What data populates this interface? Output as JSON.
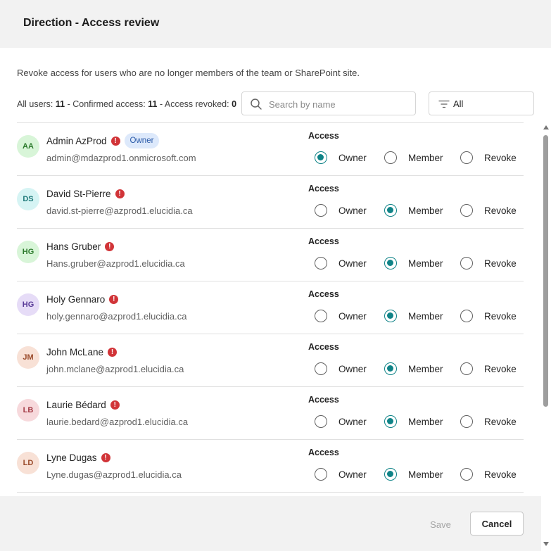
{
  "dialog": {
    "title": "Direction - Access review",
    "description": "Revoke access for users who are no longer members of the team or SharePoint site."
  },
  "stats": {
    "all_users_label": "All users:",
    "all_users_count": "11",
    "confirmed_label": "- Confirmed access:",
    "confirmed_count": "11",
    "revoked_label": "- Access revoked:",
    "revoked_count": "0"
  },
  "search": {
    "placeholder": "Search by name",
    "value": ""
  },
  "filter": {
    "label": "All"
  },
  "column": {
    "access_label": "Access"
  },
  "options": {
    "owner": "Owner",
    "member": "Member",
    "revoke": "Revoke"
  },
  "badges": {
    "owner": "Owner"
  },
  "users": [
    {
      "initials": "AA",
      "name": "Admin AzProd",
      "email": "admin@mdazprod1.onmicrosoft.com",
      "access": "owner",
      "badge": true,
      "avatar_bg": "#d8f5d8",
      "avatar_fg": "#2c7a2c"
    },
    {
      "initials": "DS",
      "name": "David St-Pierre",
      "email": "david.st-pierre@azprod1.elucidia.ca",
      "access": "member",
      "badge": false,
      "avatar_bg": "#d6f4f4",
      "avatar_fg": "#1f7a7a"
    },
    {
      "initials": "HG",
      "name": "Hans Gruber",
      "email": "Hans.gruber@azprod1.elucidia.ca",
      "access": "member",
      "badge": false,
      "avatar_bg": "#d8f5d8",
      "avatar_fg": "#2c7a2c"
    },
    {
      "initials": "HG",
      "name": "Holy Gennaro",
      "email": "holy.gennaro@azprod1.elucidia.ca",
      "access": "member",
      "badge": false,
      "avatar_bg": "#e6dcf7",
      "avatar_fg": "#5a3b99"
    },
    {
      "initials": "JM",
      "name": "John McLane",
      "email": "john.mclane@azprod1.elucidia.ca",
      "access": "member",
      "badge": false,
      "avatar_bg": "#f8e1d6",
      "avatar_fg": "#9a4a2a"
    },
    {
      "initials": "LB",
      "name": "Laurie Bédard",
      "email": "laurie.bedard@azprod1.elucidia.ca",
      "access": "member",
      "badge": false,
      "avatar_bg": "#f7d9dc",
      "avatar_fg": "#a33a45"
    },
    {
      "initials": "LD",
      "name": "Lyne Dugas",
      "email": "Lyne.dugas@azprod1.elucidia.ca",
      "access": "member",
      "badge": false,
      "avatar_bg": "#f8e1d6",
      "avatar_fg": "#9a4a2a"
    }
  ],
  "footer": {
    "save_label": "Save",
    "cancel_label": "Cancel"
  },
  "colors": {
    "accent": "#0f8387",
    "warning": "#d13438",
    "badge_bg": "#dde9fb"
  },
  "icons": {
    "search": "search-icon",
    "filter": "filter-icon",
    "warning": "warning-icon"
  }
}
